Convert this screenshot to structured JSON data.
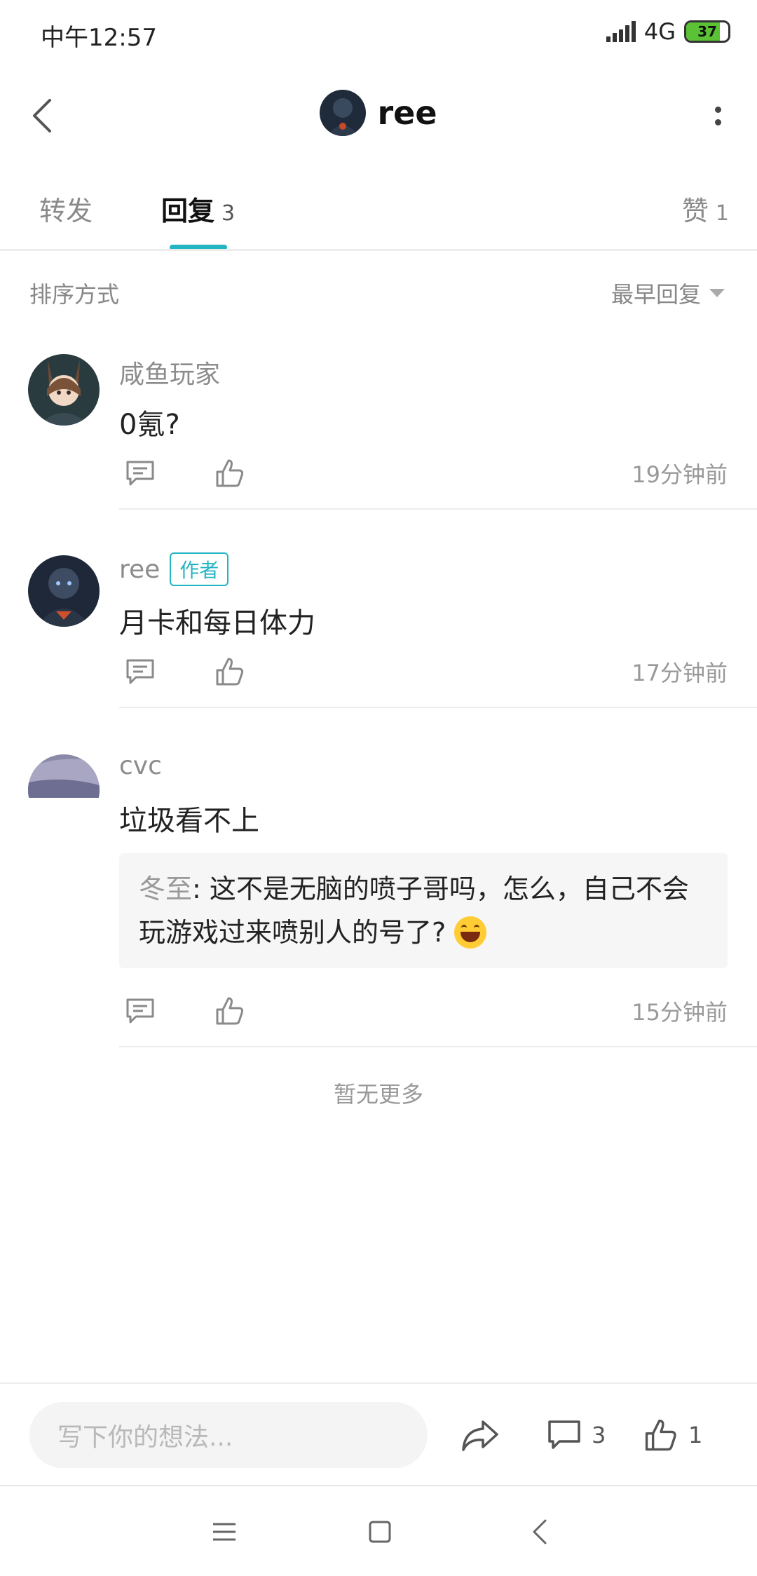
{
  "status_bar": {
    "time": "中午12:57",
    "network": "4G",
    "battery": "37"
  },
  "header": {
    "title": "ree"
  },
  "tabs": [
    {
      "label": "转发",
      "count": ""
    },
    {
      "label": "回复",
      "count": "3"
    },
    {
      "label": "赞",
      "count": "1"
    }
  ],
  "sort": {
    "label": "排序方式",
    "value": "最早回复"
  },
  "comments": [
    {
      "author": "咸鱼玩家",
      "text": "0氪?",
      "time": "19分钟前"
    },
    {
      "author": "ree",
      "badge": "作者",
      "text": "月卡和每日体力",
      "time": "17分钟前"
    },
    {
      "author": "cvc",
      "text": "垃圾看不上",
      "quote_author": "冬至",
      "quote_text": ": 这不是无脑的喷子哥吗，怎么，自己不会玩游戏过来喷别人的号了?",
      "time": "15分钟前"
    }
  ],
  "no_more": "暂无更多",
  "bottom_bar": {
    "input_placeholder": "写下你的想法...",
    "comment_count": "3",
    "like_count": "1"
  },
  "colors": {
    "accent": "#24b5c3",
    "battery": "#5bc236"
  }
}
